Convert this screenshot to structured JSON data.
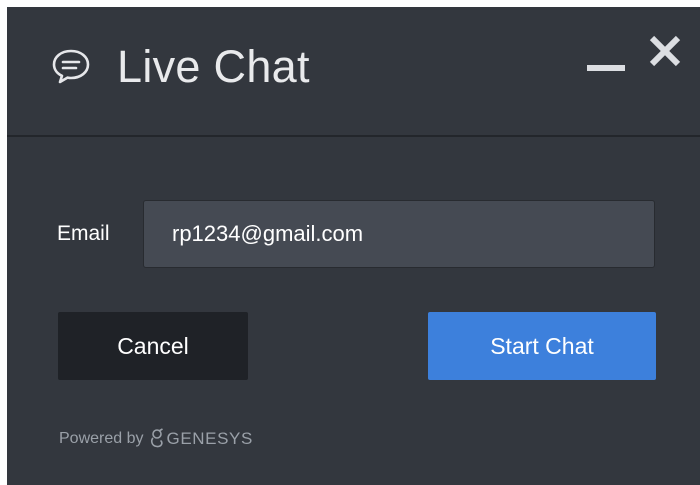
{
  "header": {
    "title": "Live Chat",
    "chat_icon": "speech-bubble-icon",
    "minimize_icon": "minimize-icon",
    "close_icon": "close-icon"
  },
  "form": {
    "email_label": "Email",
    "email_value": "rp1234@gmail.com"
  },
  "actions": {
    "cancel_label": "Cancel",
    "start_label": "Start Chat"
  },
  "footer": {
    "powered_by": "Powered by",
    "brand": "GENESYS",
    "brand_icon": "genesys-logo-icon"
  },
  "colors": {
    "background": "#33373e",
    "primary_button": "#3d80dc",
    "secondary_button": "#1f2227",
    "input_background": "#454a53"
  }
}
